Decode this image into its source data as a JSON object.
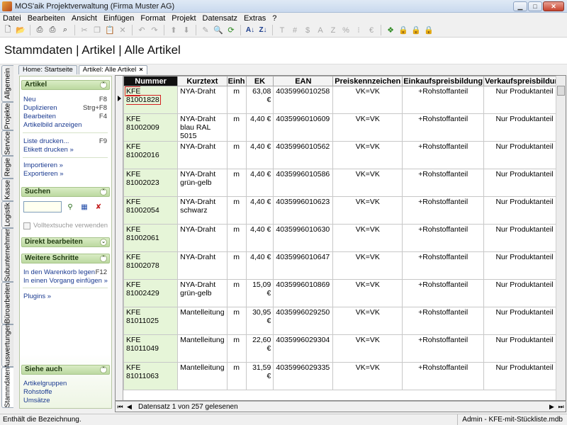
{
  "window": {
    "title": "MOS'aik Projektverwaltung (Firma Muster AG)"
  },
  "menu": [
    "Datei",
    "Bearbeiten",
    "Ansicht",
    "Einfügen",
    "Format",
    "Projekt",
    "Datensatz",
    "Extras",
    "?"
  ],
  "page": {
    "title": "Stammdaten | Artikel | Alle Artikel"
  },
  "vertical_tabs": [
    "Allgemein",
    "Projekte",
    "Service",
    "Regie",
    "Kasse",
    "Logistik",
    "Subunternehmer",
    "Büroarbeiten",
    "Auswertungen",
    "Stammdaten"
  ],
  "doc_tabs": [
    {
      "label": "Home: Startseite"
    },
    {
      "label": "Artikel: Alle Artikel",
      "close": "×"
    }
  ],
  "sidepanel": {
    "artikel": {
      "header": "Artikel",
      "items": [
        {
          "label": "Neu",
          "shortcut": "F8"
        },
        {
          "label": "Duplizieren",
          "shortcut": "Strg+F8"
        },
        {
          "label": "Bearbeiten",
          "shortcut": "F4"
        },
        {
          "label": "Artikelbild anzeigen",
          "shortcut": ""
        },
        {
          "label": "Liste drucken...",
          "shortcut": "F9"
        },
        {
          "label": "Etikett drucken »",
          "shortcut": ""
        },
        {
          "label": "Importieren »",
          "shortcut": ""
        },
        {
          "label": "Exportieren »",
          "shortcut": ""
        }
      ]
    },
    "suchen": {
      "header": "Suchen",
      "input_value": "",
      "checkbox_label": "Volltextsuche verwenden"
    },
    "direkt": {
      "header": "Direkt bearbeiten"
    },
    "weitere": {
      "header": "Weitere Schritte",
      "items": [
        {
          "label": "In den Warenkorb legen",
          "shortcut": "F12"
        },
        {
          "label": "In einen Vorgang einfügen »",
          "shortcut": ""
        },
        {
          "label": "Plugins »",
          "shortcut": ""
        }
      ]
    },
    "siehe": {
      "header": "Siehe auch",
      "items": [
        {
          "label": "Artikelgruppen"
        },
        {
          "label": "Rohstoffe"
        },
        {
          "label": "Umsätze"
        }
      ]
    }
  },
  "grid": {
    "columns": [
      "Nummer",
      "Kurztext",
      "Einh",
      "EK",
      "EAN",
      "Preiskennzeichen",
      "Einkaufspreisbildung",
      "Verkaufspreisbildung"
    ],
    "rows": [
      [
        "KFE 81001828",
        "NYA-Draht",
        "m",
        "63,08 €",
        "4035996010258",
        "VK=VK",
        "+Rohstoffanteil",
        "Nur Produktanteil"
      ],
      [
        "KFE 81002009",
        "NYA-Draht blau RAL 5015",
        "m",
        "4,40 €",
        "4035996010609",
        "VK=VK",
        "+Rohstoffanteil",
        "Nur Produktanteil"
      ],
      [
        "KFE 81002016",
        "NYA-Draht",
        "m",
        "4,40 €",
        "4035996010562",
        "VK=VK",
        "+Rohstoffanteil",
        "Nur Produktanteil"
      ],
      [
        "KFE 81002023",
        "NYA-Draht grün-gelb",
        "m",
        "4,40 €",
        "4035996010586",
        "VK=VK",
        "+Rohstoffanteil",
        "Nur Produktanteil"
      ],
      [
        "KFE 81002054",
        "NYA-Draht schwarz",
        "m",
        "4,40 €",
        "4035996010623",
        "VK=VK",
        "+Rohstoffanteil",
        "Nur Produktanteil"
      ],
      [
        "KFE 81002061",
        "NYA-Draht",
        "m",
        "4,40 €",
        "4035996010630",
        "VK=VK",
        "+Rohstoffanteil",
        "Nur Produktanteil"
      ],
      [
        "KFE 81002078",
        "NYA-Draht",
        "m",
        "4,40 €",
        "4035996010647",
        "VK=VK",
        "+Rohstoffanteil",
        "Nur Produktanteil"
      ],
      [
        "KFE 81002429",
        "NYA-Draht grün-gelb",
        "m",
        "15,09 €",
        "4035996010869",
        "VK=VK",
        "+Rohstoffanteil",
        "Nur Produktanteil"
      ],
      [
        "KFE 81011025",
        "Mantelleitung",
        "m",
        "30,95 €",
        "4035996029250",
        "VK=VK",
        "+Rohstoffanteil",
        "Nur Produktanteil"
      ],
      [
        "KFE 81011049",
        "Mantelleitung",
        "m",
        "22,60 €",
        "4035996029304",
        "VK=VK",
        "+Rohstoffanteil",
        "Nur Produktanteil"
      ],
      [
        "KFE 81011063",
        "Mantelleitung",
        "m",
        "31,59 €",
        "4035996029335",
        "VK=VK",
        "+Rohstoffanteil",
        "Nur Produktanteil"
      ]
    ]
  },
  "navbar": {
    "text": "Datensatz 1 von 257 gelesenen"
  },
  "status": {
    "left": "Enthält die Bezeichnung.",
    "right": "Admin - KFE-mit-Stückliste.mdb"
  },
  "icons": {
    "first": "first-record-icon",
    "prev": "prev-record-icon",
    "next": "next-record-icon",
    "last": "last-record-icon"
  }
}
